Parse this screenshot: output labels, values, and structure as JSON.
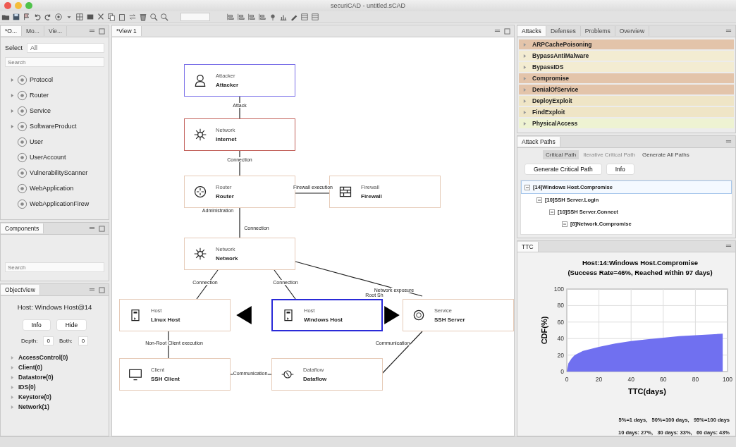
{
  "window": {
    "title": "securiCAD - untitled.sCAD"
  },
  "left_tabs": [
    {
      "label": "*O...",
      "selected": true
    },
    {
      "label": "Mo...",
      "selected": false
    },
    {
      "label": "Vie...",
      "selected": false
    }
  ],
  "palette": {
    "select_label": "Select",
    "select_value": "All",
    "search_placeholder": "Search",
    "items": [
      {
        "label": "Protocol",
        "expandable": true
      },
      {
        "label": "Router",
        "expandable": true
      },
      {
        "label": "Service",
        "expandable": true
      },
      {
        "label": "SoftwareProduct",
        "expandable": true
      },
      {
        "label": "User",
        "expandable": false
      },
      {
        "label": "UserAccount",
        "expandable": false
      },
      {
        "label": "VulnerabilityScanner",
        "expandable": false
      },
      {
        "label": "WebApplication",
        "expandable": false
      },
      {
        "label": "WebApplicationFirew",
        "expandable": false
      }
    ]
  },
  "components": {
    "tab": "Components",
    "search_placeholder": "Search"
  },
  "object_view": {
    "tab": "ObjectView",
    "title": "Host: Windows Host@14",
    "buttons": [
      "Info",
      "Hide"
    ],
    "depth_label": "Depth:",
    "depth_value": "0",
    "both_label": "Both:",
    "both_value": "0",
    "items": [
      "AccessControl(0)",
      "Client(0)",
      "Datastore(0)",
      "IDS(0)",
      "Keystore(0)",
      "Network(1)"
    ]
  },
  "editor_tab": "*View 1",
  "nodes": [
    {
      "kind": "attacker",
      "type": "Attacker",
      "name": "Attacker",
      "color": "#7a70e8",
      "selected": false
    },
    {
      "kind": "network",
      "type": "Network",
      "name": "Internet",
      "color": "#c2605a",
      "selected": false
    },
    {
      "kind": "router",
      "type": "Router",
      "name": "Router",
      "color": "#e6cbb8",
      "selected": false
    },
    {
      "kind": "firewall",
      "type": "Firewall",
      "name": "Firewall",
      "color": "#e6cbb8",
      "selected": false
    },
    {
      "kind": "network",
      "type": "Network",
      "name": "Network",
      "color": "#e6cbb8",
      "selected": false
    },
    {
      "kind": "host",
      "type": "Host",
      "name": "Linux Host",
      "color": "#e6cbb8",
      "selected": false
    },
    {
      "kind": "host",
      "type": "Host",
      "name": "Windows Host",
      "color": "#2a2ad8",
      "selected": true
    },
    {
      "kind": "service",
      "type": "Service",
      "name": "SSH Server",
      "color": "#e6cbb8",
      "selected": false
    },
    {
      "kind": "client",
      "type": "Client",
      "name": "SSH Client",
      "color": "#e6cbb8",
      "selected": false
    },
    {
      "kind": "dataflow",
      "type": "Dataflow",
      "name": "Dataflow",
      "color": "#e6cbb8",
      "selected": false
    }
  ],
  "edges": [
    {
      "label": "Attack"
    },
    {
      "label": "Connection"
    },
    {
      "label": "Firewall execution"
    },
    {
      "label": "Administration"
    },
    {
      "label": "Connection"
    },
    {
      "label": "Connection"
    },
    {
      "label": "Connection"
    },
    {
      "label": "Network exposure"
    },
    {
      "label": "Root Sh"
    },
    {
      "label": "Non-Root Client execution"
    },
    {
      "label": "Communication"
    },
    {
      "label": "Communication"
    }
  ],
  "attack_tabs": [
    {
      "label": "Attacks",
      "selected": true
    },
    {
      "label": "Defenses",
      "selected": false
    },
    {
      "label": "Problems",
      "selected": false
    },
    {
      "label": "Overview",
      "selected": false
    }
  ],
  "attacks": [
    {
      "label": "ARPCachePoisoning",
      "color": "#e3c4aa"
    },
    {
      "label": "BypassAntiMalware",
      "color": "#f3ecd2"
    },
    {
      "label": "BypassIDS",
      "color": "#f3ecd2"
    },
    {
      "label": "Compromise",
      "color": "#e3c4aa"
    },
    {
      "label": "DenialOfService",
      "color": "#e3c4aa"
    },
    {
      "label": "DeployExploit",
      "color": "#efe5c6"
    },
    {
      "label": "FindExploit",
      "color": "#efe5c6"
    },
    {
      "label": "PhysicalAccess",
      "color": "#eef3d2"
    }
  ],
  "attack_paths": {
    "tab": "Attack Paths",
    "modes": [
      {
        "label": "Critical Path",
        "selected": true,
        "disabled": false
      },
      {
        "label": "Iterative Critical Path",
        "selected": false,
        "disabled": true
      },
      {
        "label": "Generate All Paths",
        "selected": false,
        "disabled": false
      }
    ],
    "buttons": [
      "Generate Critical Path",
      "Info"
    ],
    "tree": [
      {
        "label": "[14]Windows Host.Compromise",
        "selected": true,
        "children": [
          {
            "label": "[10]SSH Server.Login",
            "selected": false,
            "children": [
              {
                "label": "[10]SSH Server.Connect",
                "selected": false,
                "children": [
                  {
                    "label": "[8]Network.Compromise",
                    "selected": false
                  }
                ]
              }
            ]
          }
        ]
      }
    ]
  },
  "ttc": {
    "tab": "TTC",
    "chart_data": {
      "type": "area",
      "title": "Host:14:Windows Host.Compromise\n(Success Rate=46%, Reached within 97 days)",
      "xlabel": "TTC(days)",
      "ylabel": "CDF(%)",
      "x": [
        0,
        1,
        3,
        5,
        10,
        20,
        30,
        40,
        50,
        60,
        70,
        80,
        90,
        97
      ],
      "series": [
        {
          "color": "#7070f0",
          "values": [
            0,
            10,
            16,
            20,
            25,
            30,
            34,
            37,
            39,
            41,
            43,
            44,
            45,
            46
          ]
        }
      ],
      "xlim": [
        0,
        100
      ],
      "ylim": [
        0,
        100
      ],
      "grid": true,
      "xticks": [
        0,
        20,
        40,
        60,
        80,
        100
      ],
      "yticks": [
        0,
        20,
        40,
        60,
        80,
        100
      ]
    },
    "summary": [
      "5%=1 days,   50%=100 days,   95%=100 days",
      "10 days: 27%,   30 days: 33%,   60 days: 43%"
    ]
  }
}
